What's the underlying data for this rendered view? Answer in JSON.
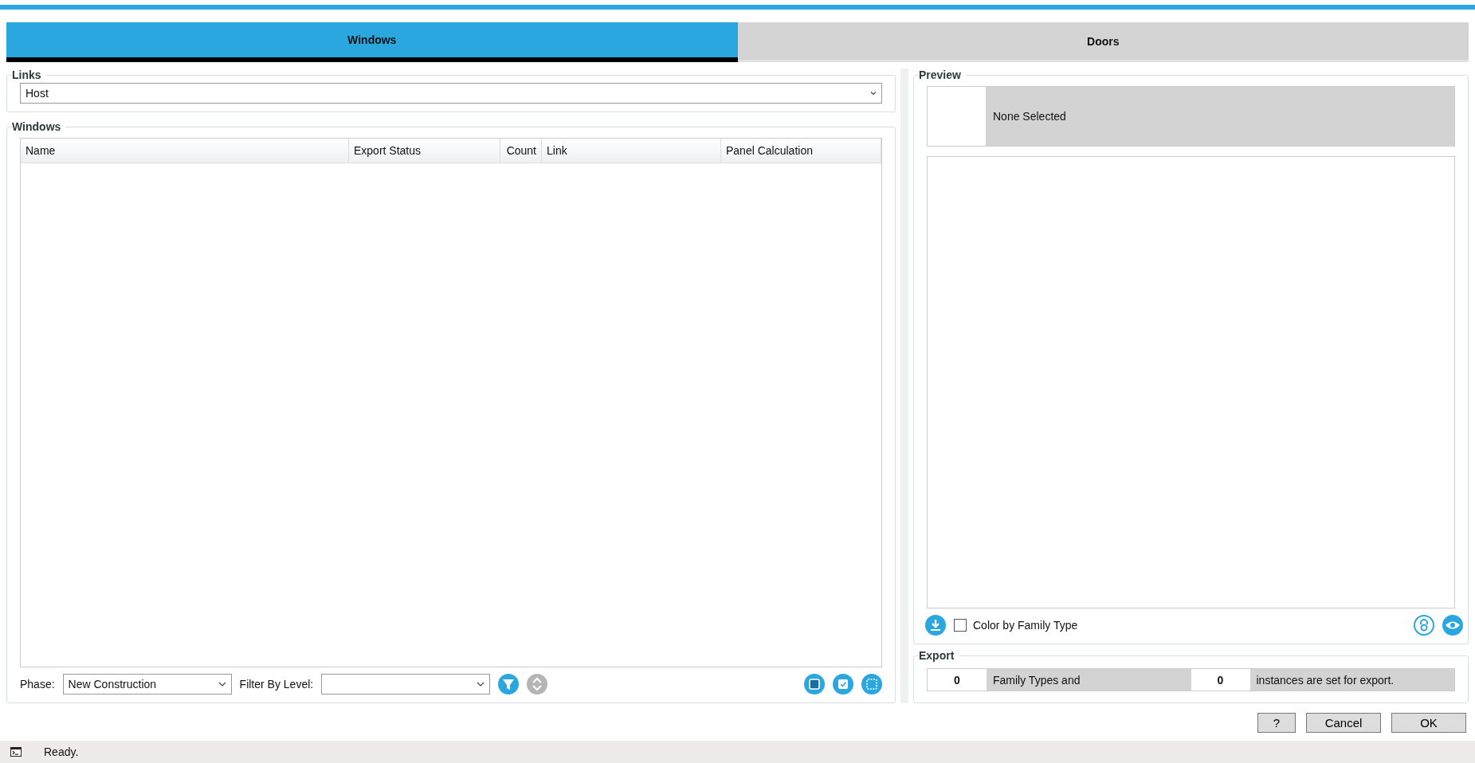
{
  "tabs": [
    {
      "label": "Windows",
      "selected": true
    },
    {
      "label": "Doors",
      "selected": false
    }
  ],
  "links": {
    "title": "Links",
    "value": "Host"
  },
  "windows": {
    "title": "Windows",
    "columns": [
      "Name",
      "Export Status",
      "Count",
      "Link",
      "Panel Calculation"
    ],
    "phase": {
      "label": "Phase:",
      "value": "New Construction"
    },
    "filter": {
      "label": "Filter By Level:"
    }
  },
  "preview": {
    "title": "Preview",
    "selection": "None Selected",
    "color_by_family_type": {
      "label": "Color by Family Type",
      "checked": false
    }
  },
  "export": {
    "title": "Export",
    "family_types_count": "0",
    "family_types_text": "Family Types and",
    "instances_count": "0",
    "instances_text": "instances are set for export."
  },
  "buttons": [
    "?",
    "Cancel",
    "OK"
  ],
  "status_bar": {
    "text": "Ready."
  }
}
